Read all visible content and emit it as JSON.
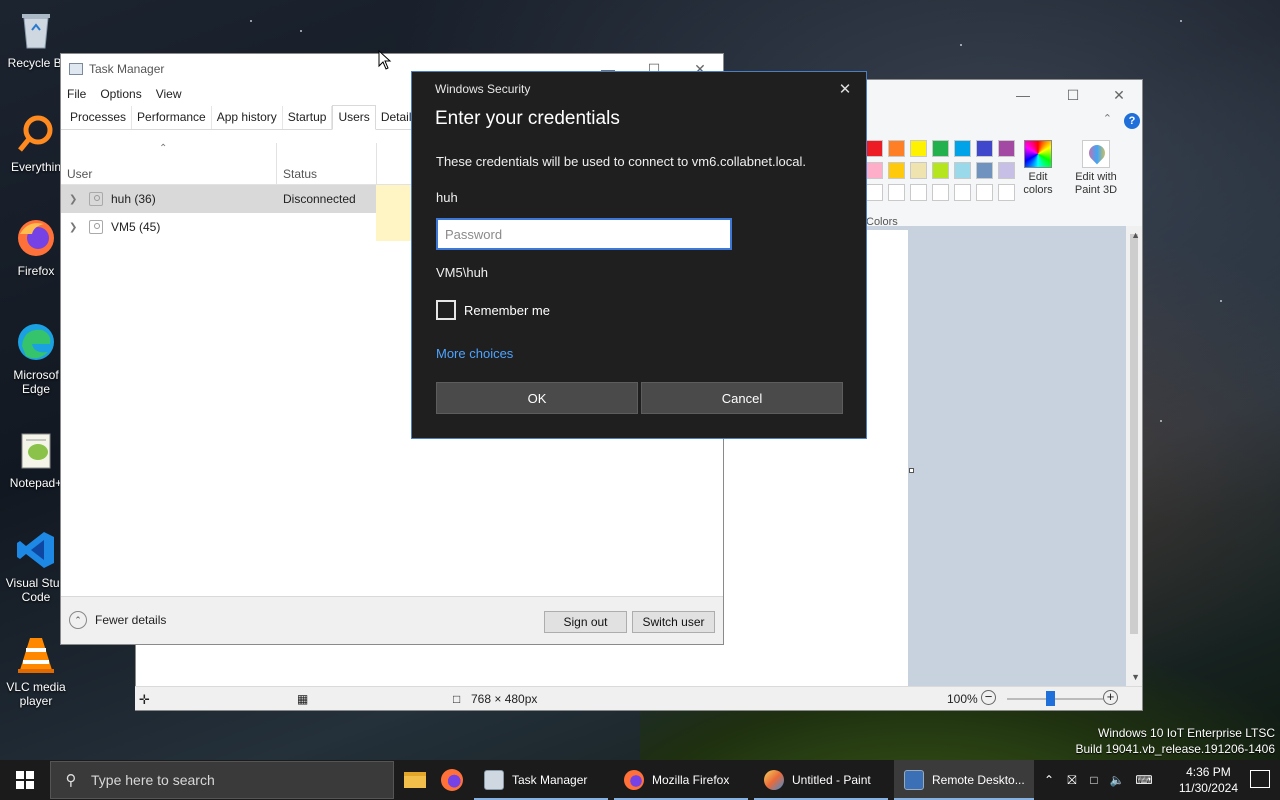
{
  "desktop": {
    "icons": [
      {
        "label": "Recycle Bi",
        "icon": "recycle-bin-icon"
      },
      {
        "label": "Everythin",
        "icon": "everything-search-icon"
      },
      {
        "label": "Firefox",
        "icon": "firefox-icon"
      },
      {
        "label": "Microsof Edge",
        "icon": "edge-icon"
      },
      {
        "label": "Notepad+",
        "icon": "notepad-plus-icon"
      },
      {
        "label": "Visual Stud Code",
        "icon": "vscode-icon"
      },
      {
        "label": "VLC media player",
        "icon": "vlc-icon"
      }
    ],
    "watermark_line1": "Windows 10 IoT Enterprise LTSC",
    "watermark_line2": "Build 19041.vb_release.191206-1406"
  },
  "task_manager": {
    "title": "Task Manager",
    "menu": [
      "File",
      "Options",
      "View"
    ],
    "tabs": [
      "Processes",
      "Performance",
      "App history",
      "Startup",
      "Users",
      "Details"
    ],
    "active_tab": "Users",
    "columns": {
      "user": "User",
      "status": "Status"
    },
    "rows": [
      {
        "name": "huh (36)",
        "status": "Disconnected"
      },
      {
        "name": "VM5 (45)",
        "status": ""
      }
    ],
    "footer": {
      "fewer_details": "Fewer details",
      "sign_out": "Sign out",
      "switch_user": "Switch user"
    }
  },
  "paint": {
    "title": "Untitled - Paint",
    "colors_label": "Colors",
    "edit_colors": "Edit colors",
    "edit_with_paint3d": "Edit with Paint 3D",
    "dimensions": "768 × 480px",
    "zoom": "100%",
    "palette_row1": [
      "#ed1c24",
      "#ff7f27",
      "#fff200",
      "#22b14c",
      "#00a2e8",
      "#3f48cc",
      "#a349a4"
    ],
    "palette_row2": [
      "#ffaec9",
      "#ffc90e",
      "#efe4b0",
      "#b5e61d",
      "#99d9ea",
      "#7092be",
      "#c8bfe7"
    ]
  },
  "security_dialog": {
    "window_title": "Windows Security",
    "heading": "Enter your credentials",
    "message": "These credentials will be used to connect to vm6.collabnet.local.",
    "username": "huh",
    "password_placeholder": "Password",
    "password_value": "",
    "domain_user": "VM5\\huh",
    "remember_me": "Remember me",
    "more_choices": "More choices",
    "ok": "OK",
    "cancel": "Cancel"
  },
  "taskbar": {
    "search_placeholder": "Type here to search",
    "items": [
      {
        "label": "Task Manager"
      },
      {
        "label": "Mozilla Firefox"
      },
      {
        "label": "Untitled - Paint"
      },
      {
        "label": "Remote Deskto..."
      }
    ],
    "time": "4:36 PM",
    "date": "11/30/2024"
  },
  "colors": {
    "accent": "#3b78d8",
    "link": "#4da3ff",
    "dialog_bg": "#1f1f1f",
    "taskbar_bg": "#1b1b1b"
  }
}
